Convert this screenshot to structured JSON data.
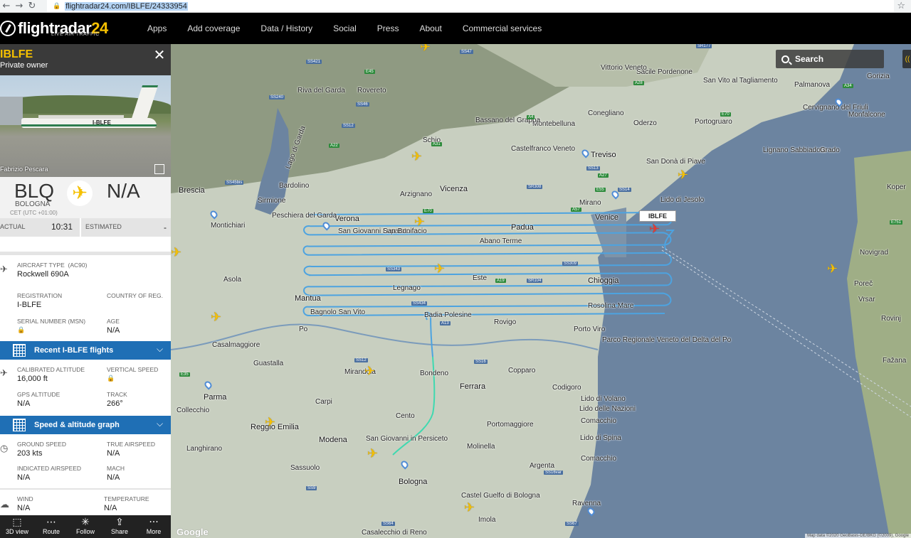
{
  "browser": {
    "url": "flightradar24.com/IBLFE/24333954"
  },
  "nav": {
    "logo_main": "flightradar",
    "logo_num": "24",
    "logo_sub": "LIVE AIR TRAFFIC",
    "links": [
      "Apps",
      "Add coverage",
      "Data / History",
      "Social",
      "Press",
      "About",
      "Commercial services"
    ]
  },
  "panel": {
    "callsign": "IBLFE",
    "owner": "Private owner",
    "photo_reg": "I-BLFE",
    "photo_credit": "Fabrizio Pescara",
    "origin_code": "BLQ",
    "origin_name": "BOLOGNA",
    "origin_tz": "CET (UTC +01:00)",
    "dest_code": "N/A",
    "actual_label": "ACTUAL",
    "actual_time": "10:31",
    "estimated_label": "ESTIMATED",
    "estimated_value": "-",
    "aircraft_type_label": "AIRCRAFT TYPE",
    "aircraft_type_code": "(AC90)",
    "aircraft_type": "Rockwell 690A",
    "registration_label": "REGISTRATION",
    "registration": "I-BLFE",
    "country_label": "COUNTRY OF REG.",
    "country_flag_colors": [
      "#009246",
      "#ffffff",
      "#ce2b37"
    ],
    "serial_label": "SERIAL NUMBER (MSN)",
    "age_label": "AGE",
    "age": "N/A",
    "recent_flights_title": "Recent I-BLFE flights",
    "calibrated_alt_label": "CALIBRATED ALTITUDE",
    "calibrated_alt": "16,000 ft",
    "vertical_speed_label": "VERTICAL SPEED",
    "gps_alt_label": "GPS ALTITUDE",
    "gps_alt": "N/A",
    "track_label": "TRACK",
    "track": "266°",
    "graph_title": "Speed & altitude graph",
    "ground_speed_label": "GROUND SPEED",
    "ground_speed": "203 kts",
    "true_airspeed_label": "TRUE AIRSPEED",
    "true_airspeed": "N/A",
    "indicated_airspeed_label": "INDICATED AIRSPEED",
    "indicated_airspeed": "N/A",
    "mach_label": "MACH",
    "mach": "N/A",
    "wind_label": "WIND",
    "wind": "N/A",
    "temperature_label": "TEMPERATURE",
    "temperature": "N/A"
  },
  "bottom_bar": [
    "3D view",
    "Route",
    "Follow",
    "Share",
    "More"
  ],
  "map": {
    "search_label": "Search",
    "flight_tag": "IBLFE",
    "attribution": "Map data ©2020 GeoBasis-DE/BKG (©2009), Google",
    "google": "Google",
    "accent_track": "#4da3e0",
    "accent_climb": "#3fd9b0",
    "places": [
      {
        "name": "Verona",
        "big": true
      },
      {
        "name": "Vicenza",
        "big": true
      },
      {
        "name": "Padua",
        "big": true
      },
      {
        "name": "Venice",
        "big": true
      },
      {
        "name": "Treviso",
        "big": true
      },
      {
        "name": "Bologna",
        "big": true
      },
      {
        "name": "Ferrara",
        "big": true
      },
      {
        "name": "Modena",
        "big": true
      },
      {
        "name": "Mantua",
        "big": true
      },
      {
        "name": "Chioggia",
        "big": true
      },
      {
        "name": "Parma",
        "big": true
      },
      {
        "name": "Reggio Emilia",
        "big": true
      },
      {
        "name": "Brescia",
        "big": true
      },
      {
        "name": "Rovigo",
        "big": false
      },
      {
        "name": "Legnago",
        "big": false
      },
      {
        "name": "Este",
        "big": false
      },
      {
        "name": "Abano Terme",
        "big": false
      },
      {
        "name": "San Giovanni Lupatoto",
        "big": false
      },
      {
        "name": "San Bonifacio",
        "big": false
      },
      {
        "name": "Rosolina Mare",
        "big": false
      },
      {
        "name": "Porto Viro",
        "big": false
      },
      {
        "name": "Badia Polesine",
        "big": false
      },
      {
        "name": "Mirandola",
        "big": false
      },
      {
        "name": "Cento",
        "big": false
      },
      {
        "name": "San Giovanni in Persiceto",
        "big": false
      },
      {
        "name": "Bondeno",
        "big": false
      },
      {
        "name": "Copparo",
        "big": false
      },
      {
        "name": "Codigoro",
        "big": false
      },
      {
        "name": "Comacchio",
        "big": false
      },
      {
        "name": "Portomaggiore",
        "big": false
      },
      {
        "name": "Molinella",
        "big": false
      },
      {
        "name": "Argenta",
        "big": false
      },
      {
        "name": "Imola",
        "big": false
      },
      {
        "name": "Ravenna",
        "big": false
      },
      {
        "name": "Carpi",
        "big": false
      },
      {
        "name": "Sassuolo",
        "big": false
      },
      {
        "name": "Guastalla",
        "big": false
      },
      {
        "name": "Casalmaggiore",
        "big": false
      },
      {
        "name": "Asola",
        "big": false
      },
      {
        "name": "Castelfranco Veneto",
        "big": false
      },
      {
        "name": "Montebelluna",
        "big": false
      },
      {
        "name": "Bassano del Grappa",
        "big": false
      },
      {
        "name": "Conegliano",
        "big": false
      },
      {
        "name": "Schio",
        "big": false
      },
      {
        "name": "Arzignano",
        "big": false
      },
      {
        "name": "Mirano",
        "big": false
      },
      {
        "name": "Lido di Jesolo",
        "big": false
      },
      {
        "name": "San Donà di Piave",
        "big": false
      },
      {
        "name": "Portogruaro",
        "big": false
      },
      {
        "name": "Pordenone",
        "big": false
      },
      {
        "name": "Lignano Sabbiadoro",
        "big": false
      },
      {
        "name": "Grado",
        "big": false
      },
      {
        "name": "Monfalcone",
        "big": false
      },
      {
        "name": "Koper",
        "big": false
      },
      {
        "name": "Novigrad",
        "big": false
      },
      {
        "name": "Poreč",
        "big": false
      },
      {
        "name": "Vrsar",
        "big": false
      },
      {
        "name": "Rovinj",
        "big": false
      },
      {
        "name": "Sirmione",
        "big": false
      },
      {
        "name": "Peschiera del Garda",
        "big": false
      },
      {
        "name": "Bardolino",
        "big": false
      },
      {
        "name": "Montichiari",
        "big": false
      },
      {
        "name": "Riva del Garda",
        "big": false
      },
      {
        "name": "Rovereto",
        "big": false
      },
      {
        "name": "Lido di Spina",
        "big": false
      },
      {
        "name": "Parco Regionale Veneto del Delta del Po",
        "big": false
      },
      {
        "name": "Castel Guelfo di Bologna",
        "big": false
      },
      {
        "name": "Oderzo",
        "big": false
      },
      {
        "name": "Sacile",
        "big": false
      },
      {
        "name": "San Vito al Tagliamento",
        "big": false
      },
      {
        "name": "Palmanova",
        "big": false
      },
      {
        "name": "Cervignano del Friuli",
        "big": false
      },
      {
        "name": "Gorizia",
        "big": false
      },
      {
        "name": "Vittorio Veneto",
        "big": false
      },
      {
        "name": "Collecchio",
        "big": false
      },
      {
        "name": "Langhirano",
        "big": false
      },
      {
        "name": "Bagnolo San Vito",
        "big": false
      },
      {
        "name": "Casalecchio di Reno",
        "big": false
      },
      {
        "name": "Comacchio",
        "big": false
      },
      {
        "name": "Lido delle Nazioni",
        "big": false
      },
      {
        "name": "Lido di Volano",
        "big": false
      },
      {
        "name": "Fažana",
        "big": false
      },
      {
        "name": "Po",
        "big": false
      },
      {
        "name": "Lago di Garda",
        "big": false
      }
    ],
    "roads": [
      "SS421",
      "SS47",
      "SS240",
      "SS46",
      "SS12",
      "A22",
      "A31",
      "E45",
      "E70",
      "A4",
      "A27",
      "SS13",
      "E55",
      "SR308",
      "SS14",
      "A57",
      "SS45bis",
      "SS343",
      "SS434",
      "A13",
      "SS16",
      "SR104",
      "SS309",
      "A19",
      "E35",
      "SS12",
      "SS9",
      "SS64",
      "SR177",
      "A28",
      "E70",
      "A34",
      "E751",
      "SS67",
      "SS16var"
    ]
  }
}
